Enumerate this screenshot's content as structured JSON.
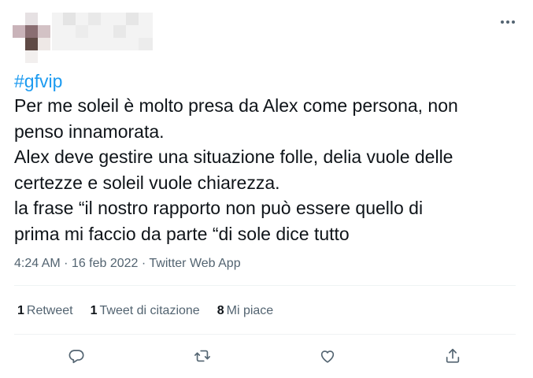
{
  "tweet": {
    "hashtag": "#gfvip",
    "lines": [
      "Per me soleil è molto presa da Alex come persona, non",
      "penso innamorata.",
      "Alex deve gestire una situazione folle, delia vuole delle",
      "certezze e soleil vuole chiarezza.",
      "la frase “il nostro rapporto non può essere quello di",
      "prima mi faccio da parte “di sole dice tutto"
    ],
    "time": "4:24 AM",
    "sep1": " · ",
    "date": "16 feb 2022",
    "sep2": " · ",
    "source": "Twitter Web App"
  },
  "stats": {
    "retweets_count": "1",
    "retweets_label": "Retweet",
    "quotes_count": "1",
    "quotes_label": "Tweet di citazione",
    "likes_count": "8",
    "likes_label": "Mi piace"
  },
  "icons": {
    "more": "more-horizontal-icon",
    "reply": "reply-icon",
    "retweet": "retweet-icon",
    "like": "heart-icon",
    "share": "share-icon"
  },
  "colors": {
    "accent": "#1d9bf0",
    "text": "#0f1419",
    "secondary": "#536471",
    "divider": "#eff3f4"
  }
}
